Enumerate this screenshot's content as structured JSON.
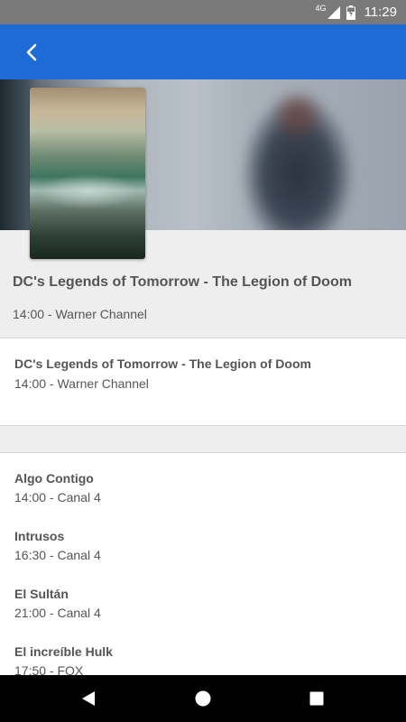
{
  "status_bar": {
    "network": "4G",
    "time": "11:29"
  },
  "app_bar": {
    "accent_color": "#1e6bd6",
    "back_icon": "chevron-left-icon"
  },
  "header": {
    "title": "DC's Legends of Tomorrow - The Legion of Doom",
    "subtitle": "14:00 - Warner Channel"
  },
  "detail": {
    "title": "DC's Legends of Tomorrow - The Legion of Doom",
    "subtitle": "14:00 - Warner Channel"
  },
  "list": [
    {
      "title": "Algo Contigo",
      "subtitle": "14:00 - Canal 4"
    },
    {
      "title": "Intrusos",
      "subtitle": "16:30 - Canal 4"
    },
    {
      "title": "El Sultán",
      "subtitle": "21:00 - Canal 4"
    },
    {
      "title": "El increíble Hulk",
      "subtitle": "17:50 - FOX"
    }
  ],
  "nav": {
    "back": "triangle-back-icon",
    "home": "circle-home-icon",
    "recents": "square-recents-icon"
  }
}
